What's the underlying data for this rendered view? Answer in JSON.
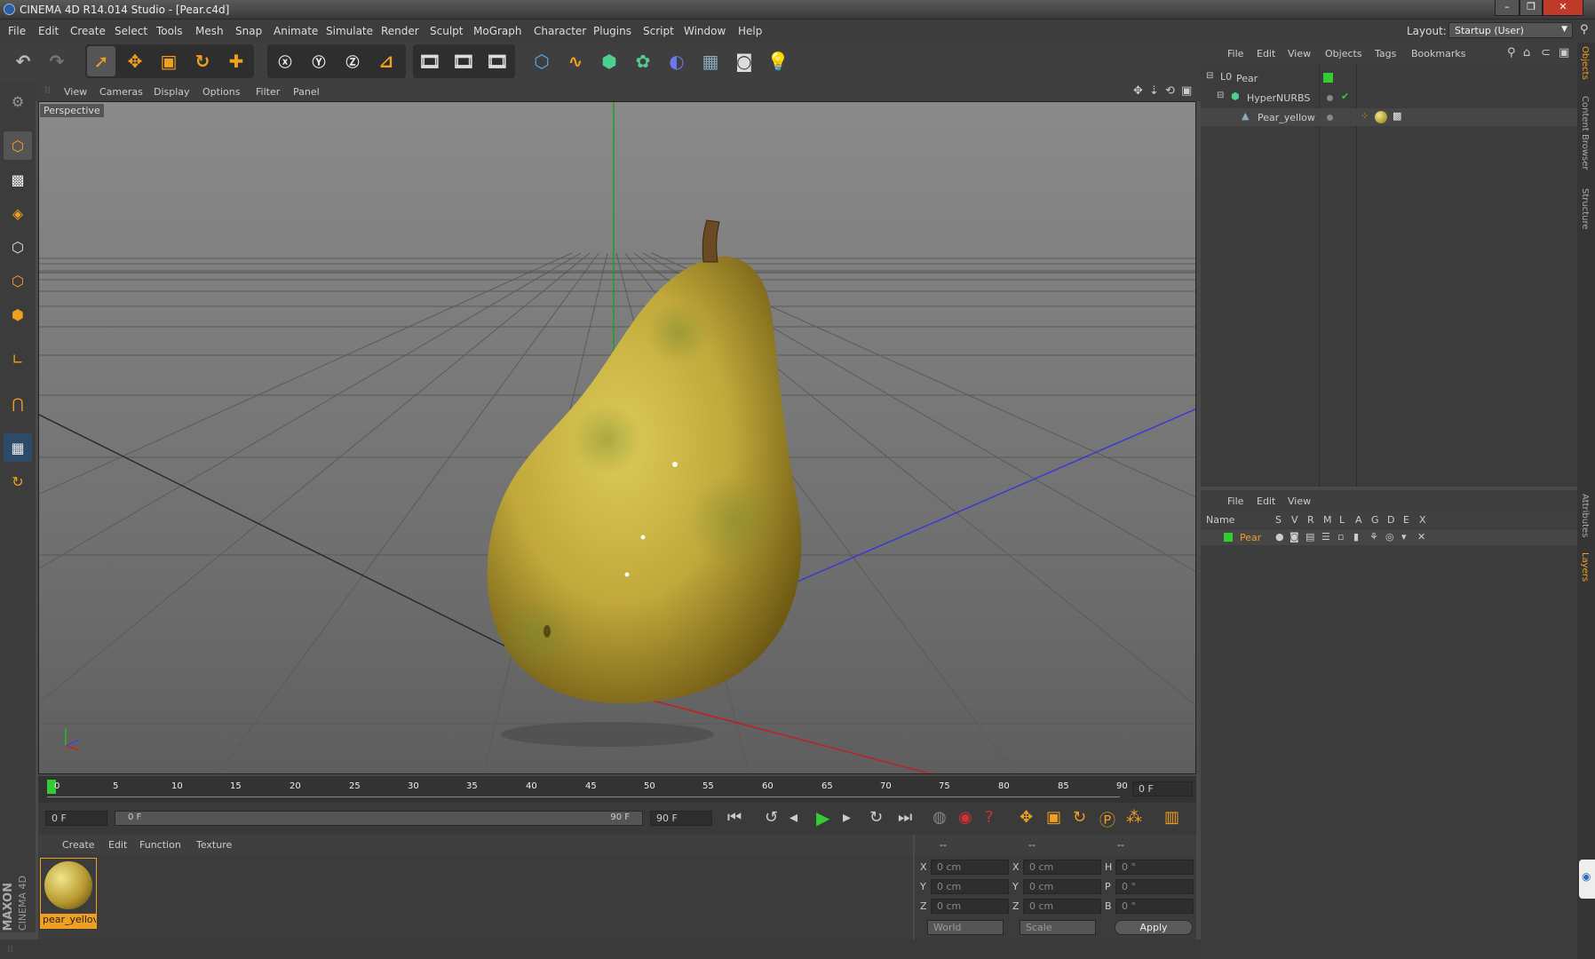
{
  "window": {
    "title": "CINEMA 4D R14.014 Studio - [Pear.c4d]"
  },
  "menubar": {
    "items": [
      "File",
      "Edit",
      "Create",
      "Select",
      "Tools",
      "Mesh",
      "Snap",
      "Animate",
      "Simulate",
      "Render",
      "Sculpt",
      "MoGraph",
      "Character",
      "Plugins",
      "Script",
      "Window",
      "Help"
    ],
    "layout_label": "Layout:",
    "layout_value": "Startup (User)"
  },
  "viewport": {
    "menu": [
      "View",
      "Cameras",
      "Display",
      "Options",
      "Filter",
      "Panel"
    ],
    "label": "Perspective"
  },
  "objects_panel": {
    "menu": [
      "File",
      "Edit",
      "View",
      "Objects",
      "Tags",
      "Bookmarks"
    ],
    "tree": [
      {
        "name": "Pear",
        "depth": 0
      },
      {
        "name": "HyperNURBS",
        "depth": 1
      },
      {
        "name": "Pear_yellow",
        "depth": 2
      }
    ]
  },
  "layers_panel": {
    "menu": [
      "File",
      "Edit",
      "View"
    ],
    "columns": [
      "Name",
      "S",
      "V",
      "R",
      "M",
      "L",
      "A",
      "G",
      "D",
      "E",
      "X"
    ],
    "rows": [
      {
        "name": "Pear",
        "color": "#33cc33"
      }
    ]
  },
  "timeline": {
    "ticks": [
      "0",
      "5",
      "10",
      "15",
      "20",
      "25",
      "30",
      "35",
      "40",
      "45",
      "50",
      "55",
      "60",
      "65",
      "70",
      "75",
      "80",
      "85",
      "90"
    ],
    "current": "0 F"
  },
  "timeline_controls": {
    "start": "0 F",
    "range_left": "0 F",
    "range_right": "90 F",
    "end": "90 F"
  },
  "material_panel": {
    "menu": [
      "Create",
      "Edit",
      "Function",
      "Texture"
    ],
    "materials": [
      {
        "name": "pear_yellov"
      }
    ]
  },
  "coord_panel": {
    "headers": [
      "--",
      "--",
      "--"
    ],
    "rows": [
      {
        "a": "X",
        "av": "0 cm",
        "b": "X",
        "bv": "0 cm",
        "c": "H",
        "cv": "0 °"
      },
      {
        "a": "Y",
        "av": "0 cm",
        "b": "Y",
        "bv": "0 cm",
        "c": "P",
        "cv": "0 °"
      },
      {
        "a": "Z",
        "av": "0 cm",
        "b": "Z",
        "bv": "0 cm",
        "c": "B",
        "cv": "0 °"
      }
    ],
    "mode": "World",
    "size_mode": "Scale",
    "apply": "Apply"
  },
  "right_tabs": [
    "Objects",
    "Content Browser",
    "Structure",
    "Attributes",
    "Layers"
  ],
  "brand": {
    "maker": "MAXON",
    "product": "CINEMA 4D"
  },
  "colors": {
    "accent": "#f0a020",
    "pear_dark": "#8a7a10",
    "pear_light": "#d8c850",
    "active_green": "#33cc33"
  }
}
